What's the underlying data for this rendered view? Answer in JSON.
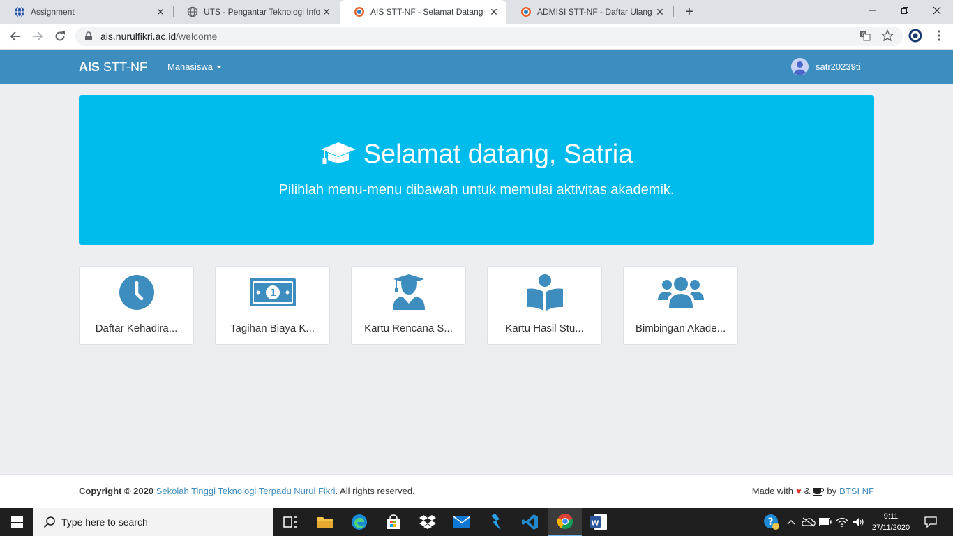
{
  "browser": {
    "tabs": [
      {
        "title": "Assignment",
        "active": false
      },
      {
        "title": "UTS - Pengantar Teknologi Inform",
        "active": false
      },
      {
        "title": "AIS STT-NF - Selamat Datang",
        "active": true
      },
      {
        "title": "ADMISI STT-NF - Daftar Ulang",
        "active": false
      }
    ],
    "url_host": "ais.nurulfikri.ac.id",
    "url_path": "/welcome"
  },
  "navbar": {
    "brand_bold": "AIS",
    "brand_rest": " STT-NF",
    "menu_label": "Mahasiswa",
    "username": "satr20239ti"
  },
  "hero": {
    "title": "Selamat datang, Satria",
    "subtitle": "Pilihlah menu-menu dibawah untuk memulai aktivitas akademik.",
    "color": "#00bced"
  },
  "tiles": [
    {
      "label": "Daftar Kehadira...",
      "icon": "clock-icon"
    },
    {
      "label": "Tagihan Biaya K...",
      "icon": "money-bill-icon"
    },
    {
      "label": "Kartu Rencana S...",
      "icon": "graduate-user-icon"
    },
    {
      "label": "Kartu Hasil Stu...",
      "icon": "reading-user-icon"
    },
    {
      "label": "Bimbingan Akade...",
      "icon": "users-icon"
    }
  ],
  "footer": {
    "copyright_prefix": "Copyright © 2020",
    "institution": "Sekolah Tinggi Teknologi Terpadu Nurul Fikri",
    "rights": ". All rights reserved.",
    "made_with": "Made with",
    "amp": "&",
    "by": "by",
    "team": "BTSI NF"
  },
  "taskbar": {
    "search_placeholder": "Type here to search",
    "time": "9:11",
    "date": "27/11/2020"
  },
  "colors": {
    "navbar": "#3d8dbf",
    "accent_icon": "#3d8dbf",
    "link": "#3d8dbf",
    "background": "#eceef1"
  }
}
